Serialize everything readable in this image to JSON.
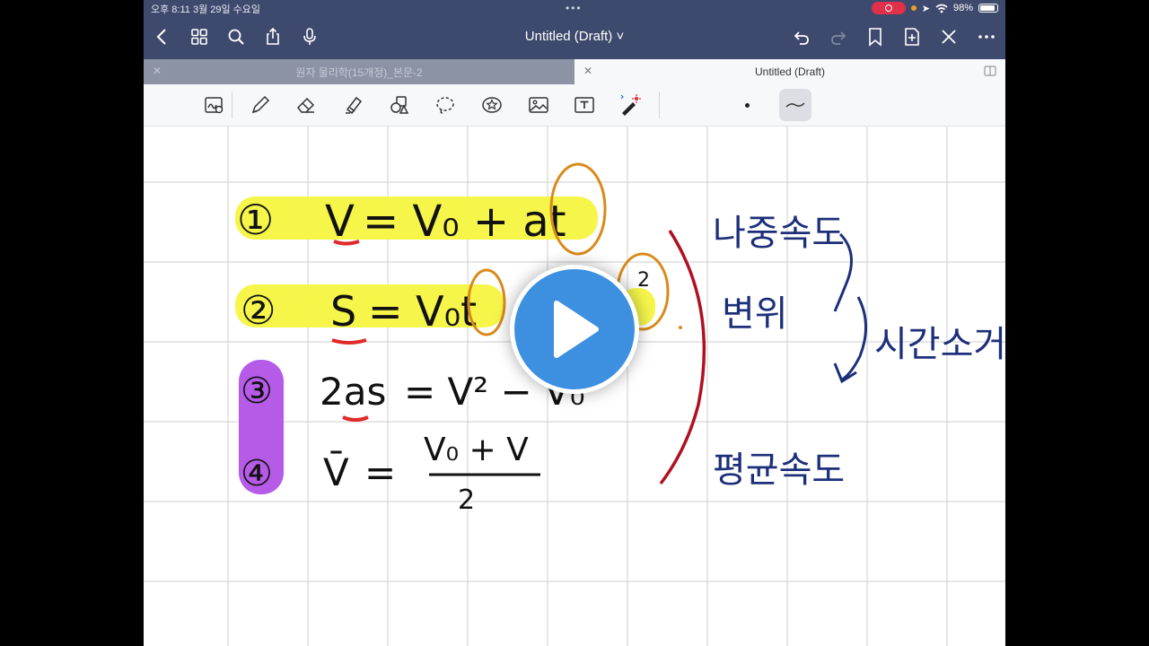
{
  "status_bar": {
    "time_date": "오후 8:11   3월 29일 수요일",
    "battery": "98%"
  },
  "nav": {
    "title": "Untitled (Draft) ˅"
  },
  "tabs": [
    {
      "label": "원자 물리학(15개정)_본문-2",
      "active": false
    },
    {
      "label": "Untitled (Draft)",
      "active": true
    }
  ],
  "notes": {
    "eq1": {
      "num": "①",
      "lhs": "V",
      "rhs": "= V₀ + at"
    },
    "eq2": {
      "num": "②",
      "lhs": "S",
      "rhs": "= V₀t"
    },
    "eq2_exp": "2",
    "eq3": {
      "num": "③",
      "lhs": "2as",
      "rhs": "= V² − V₀"
    },
    "eq4": {
      "num": "④",
      "lhs": "V̄",
      "eq": "=",
      "numerator": "V₀ + V",
      "denominator": "2"
    },
    "label_final_velocity": "나중속도",
    "label_displacement": "변위",
    "label_time_removed": "시간소거.",
    "label_avg_velocity": "평균속도"
  },
  "colors": {
    "highlight_yellow": "#f5f54a",
    "highlight_purple": "#b55be8",
    "ink_black": "#111111",
    "ink_red": "#b01020",
    "ink_navy": "#1d2f7a",
    "ink_orange": "#d98a1a",
    "play_blue": "#3d8fe0"
  }
}
